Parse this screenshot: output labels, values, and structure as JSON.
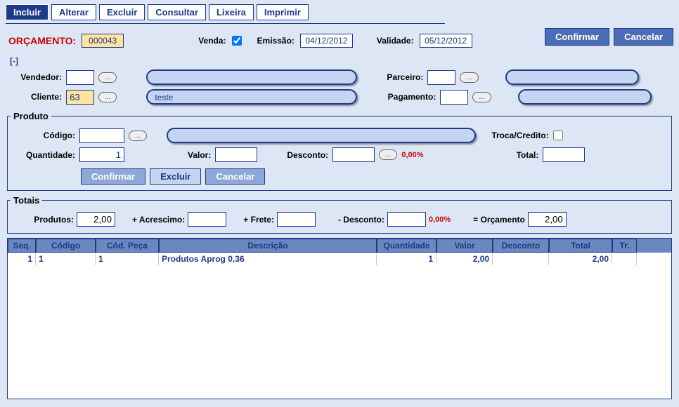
{
  "toolbar": {
    "incluir": "Incluir",
    "alterar": "Alterar",
    "excluir": "Excluir",
    "consultar": "Consultar",
    "lixeira": "Lixeira",
    "imprimir": "Imprimir"
  },
  "actions": {
    "confirmar": "Confirmar",
    "cancelar": "Cancelar"
  },
  "header": {
    "orcamento_label": "ORÇAMENTO:",
    "orcamento_num": "000043",
    "venda_label": "Venda:",
    "venda_checked": true,
    "emissao_label": "Emissão:",
    "emissao_value": "04/12/2012",
    "validade_label": "Validade:",
    "validade_value": "05/12/2012"
  },
  "collapse": "[-]",
  "form": {
    "vendedor_label": "Vendedor:",
    "vendedor_value": "",
    "vendedor_display": "",
    "parceiro_label": "Parceiro:",
    "parceiro_value": "",
    "parceiro_display": "",
    "cliente_label": "Cliente:",
    "cliente_value": "63",
    "cliente_display": "teste",
    "pagamento_label": "Pagamento:",
    "pagamento_value": "",
    "pagamento_display": "",
    "ellipsis": "..."
  },
  "produto": {
    "legend": "Produto",
    "codigo_label": "Código:",
    "codigo_value": "",
    "codigo_display": "",
    "troca_label": "Troca/Credito:",
    "quantidade_label": "Quantidade:",
    "quantidade_value": "1",
    "valor_label": "Valor:",
    "valor_value": "",
    "desconto_label": "Desconto:",
    "desconto_value": "",
    "desconto_pct": "0,00%",
    "total_label": "Total:",
    "total_value": "",
    "btn_confirmar": "Confirmar",
    "btn_excluir": "Excluir",
    "btn_cancelar": "Cancelar",
    "ellipsis": "..."
  },
  "totais": {
    "legend": "Totais",
    "produtos_label": "Produtos:",
    "produtos_value": "2,00",
    "acrescimo_label": "+ Acrescimo:",
    "acrescimo_value": "",
    "frete_label": "+ Frete:",
    "frete_value": "",
    "desconto_label": "- Desconto:",
    "desconto_value": "",
    "desconto_pct": "0,00%",
    "orcamento_label": "= Orçamento",
    "orcamento_value": "2,00"
  },
  "grid": {
    "headers": {
      "seq": "Seq.",
      "codigo": "Código",
      "peca": "Cód. Peça",
      "descricao": "Descrição",
      "quantidade": "Quantidade",
      "valor": "Valor",
      "desconto": "Desconto",
      "total": "Total",
      "tr": "Tr."
    },
    "rows": [
      {
        "seq": "1",
        "codigo": "1",
        "peca": "1",
        "descricao": "Produtos Aprog 0,36",
        "quantidade": "1",
        "valor": "2,00",
        "desconto": "",
        "total": "2,00",
        "tr": ""
      }
    ]
  }
}
